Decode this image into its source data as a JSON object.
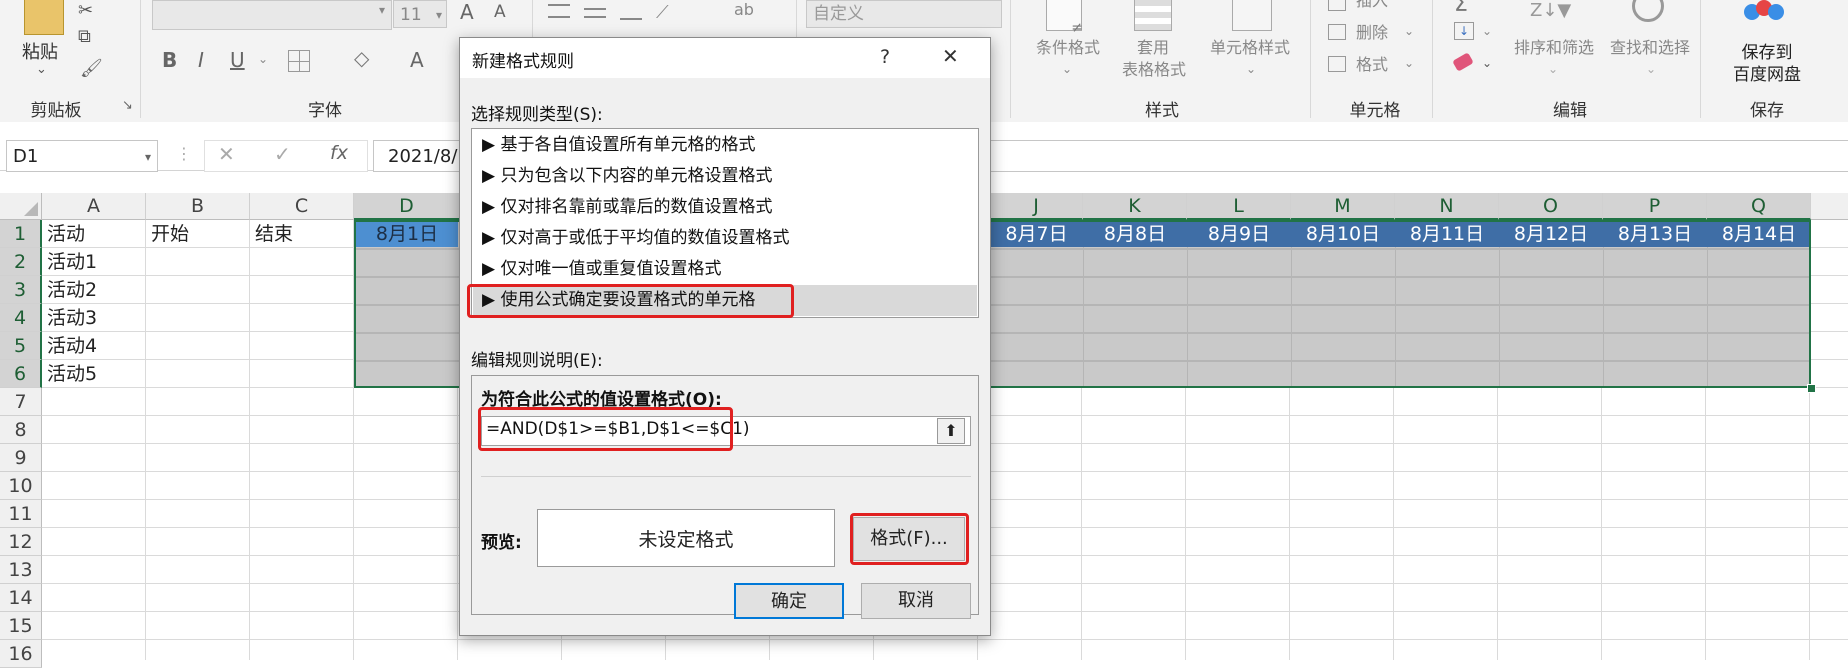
{
  "ribbon": {
    "clipboard": {
      "paste_label": "粘贴",
      "group_label": "剪贴板"
    },
    "font": {
      "font_name_value": "",
      "font_size_value": "11",
      "bold": "B",
      "italic": "I",
      "underline": "U",
      "increase": "A",
      "decrease": "A",
      "font_color": "A",
      "group_label": "字体"
    },
    "alignment": {
      "wrap_label": "ab"
    },
    "number": {
      "format_value": "自定义"
    },
    "styles": {
      "conditional_label": "条件格式",
      "table_label_1": "套用",
      "table_label_2": "表格格式",
      "cellstyle_label": "单元格样式",
      "group_label": "样式"
    },
    "cells": {
      "insert_label": "插入",
      "delete_label": "删除",
      "format_label": "格式",
      "group_label": "单元格"
    },
    "editing": {
      "sort_label": "排序和筛选",
      "find_label": "查找和选择",
      "group_label": "编辑"
    },
    "save": {
      "label_1": "保存到",
      "label_2": "百度网盘",
      "group_label": "保存"
    }
  },
  "formula_bar": {
    "name_box": "D1",
    "fx": "fx",
    "formula_value": "2021/8/"
  },
  "sheet": {
    "columns_left": [
      "A",
      "B",
      "C",
      "D"
    ],
    "columns_right": [
      "J",
      "K",
      "L",
      "M",
      "N",
      "O",
      "P",
      "Q"
    ],
    "rows": [
      "1",
      "2",
      "3",
      "4",
      "5",
      "6",
      "7",
      "8",
      "9",
      "10",
      "11",
      "12",
      "13",
      "14",
      "15",
      "16"
    ],
    "col_a": [
      "活动",
      "活动1",
      "活动2",
      "活动3",
      "活动4",
      "活动5"
    ],
    "b1": "开始",
    "c1": "结束",
    "d1": "8月1日",
    "dates_right": [
      "8月7日",
      "8月8日",
      "8月9日",
      "8月10日",
      "8月11日",
      "8月12日",
      "8月13日",
      "8月14日"
    ]
  },
  "dialog": {
    "title": "新建格式规则",
    "help": "?",
    "close": "✕",
    "section1_label": "选择规则类型(S):",
    "rule_types": [
      "▶ 基于各自值设置所有单元格的格式",
      "▶ 只为包含以下内容的单元格设置格式",
      "▶ 仅对排名靠前或靠后的数值设置格式",
      "▶ 仅对高于或低于平均值的数值设置格式",
      "▶ 仅对唯一值或重复值设置格式",
      "▶ 使用公式确定要设置格式的单元格"
    ],
    "section2_label": "编辑规则说明(E):",
    "formula_label": "为符合此公式的值设置格式(O):",
    "formula_value": "=AND(D$1>=$B1,D$1<=$C1)",
    "preview_label": "预览:",
    "preview_text": "未设定格式",
    "format_button": "格式(F)...",
    "ok_button": "确定",
    "cancel_button": "取消"
  },
  "colors": {
    "excel_green": "#217346",
    "selection_gray": "#c8c8c8",
    "date_header_blue": "#3f6ea6",
    "highlight_red": "#e02020"
  }
}
